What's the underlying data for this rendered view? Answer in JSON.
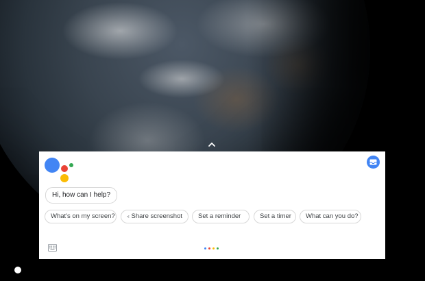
{
  "assistant": {
    "greeting": "Hi, how can I help?",
    "suggestions": [
      "What's on my screen?",
      "Share screenshot",
      "Set a reminder",
      "Set a timer",
      "What can you do?"
    ]
  },
  "colors": {
    "assistant_blue": "#4285f4",
    "assistant_red": "#ea4335",
    "assistant_yellow": "#fbbc05",
    "assistant_green": "#34a853"
  },
  "icons": {
    "logo": "google-assistant-logo",
    "inbox": "inbox-icon",
    "share": "share-icon",
    "keyboard": "keyboard-icon",
    "expand": "chevron-up-icon",
    "home": "home-dot"
  }
}
